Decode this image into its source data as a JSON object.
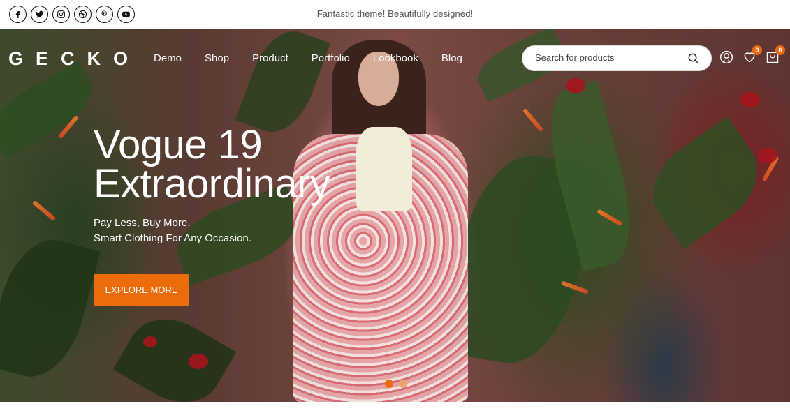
{
  "topbar": {
    "socials": [
      {
        "icon": "facebook-icon",
        "label": "Facebook"
      },
      {
        "icon": "twitter-icon",
        "label": "Twitter"
      },
      {
        "icon": "instagram-icon",
        "label": "Instagram"
      },
      {
        "icon": "dribbble-icon",
        "label": "Dribbble"
      },
      {
        "icon": "pinterest-icon",
        "label": "Pinterest"
      },
      {
        "icon": "youtube-icon",
        "label": "YouTube"
      }
    ],
    "announcement": "Fantastic theme! Beautifully designed!"
  },
  "header": {
    "logo": "GECKO",
    "menu": [
      "Demo",
      "Shop",
      "Product",
      "Portfolio",
      "Lookbook",
      "Blog"
    ],
    "search": {
      "placeholder": "Search for products",
      "value": ""
    },
    "account_icon": "user-icon",
    "wishlist": {
      "icon": "heart-icon",
      "count": "0"
    },
    "cart": {
      "icon": "bag-icon",
      "count": "0"
    }
  },
  "hero": {
    "headline_line1": "Vogue 19",
    "headline_line2": "Extraordinary",
    "subline1": "Pay Less, Buy More.",
    "subline2": "Smart Clothing For Any Occasion.",
    "cta": "EXPLORE MORE",
    "slides": 2,
    "active_slide": 1
  },
  "colors": {
    "accent": "#ec6b0a",
    "badge": "#ec6b12",
    "text_light": "#ffffff",
    "announcement_text": "#555555"
  }
}
